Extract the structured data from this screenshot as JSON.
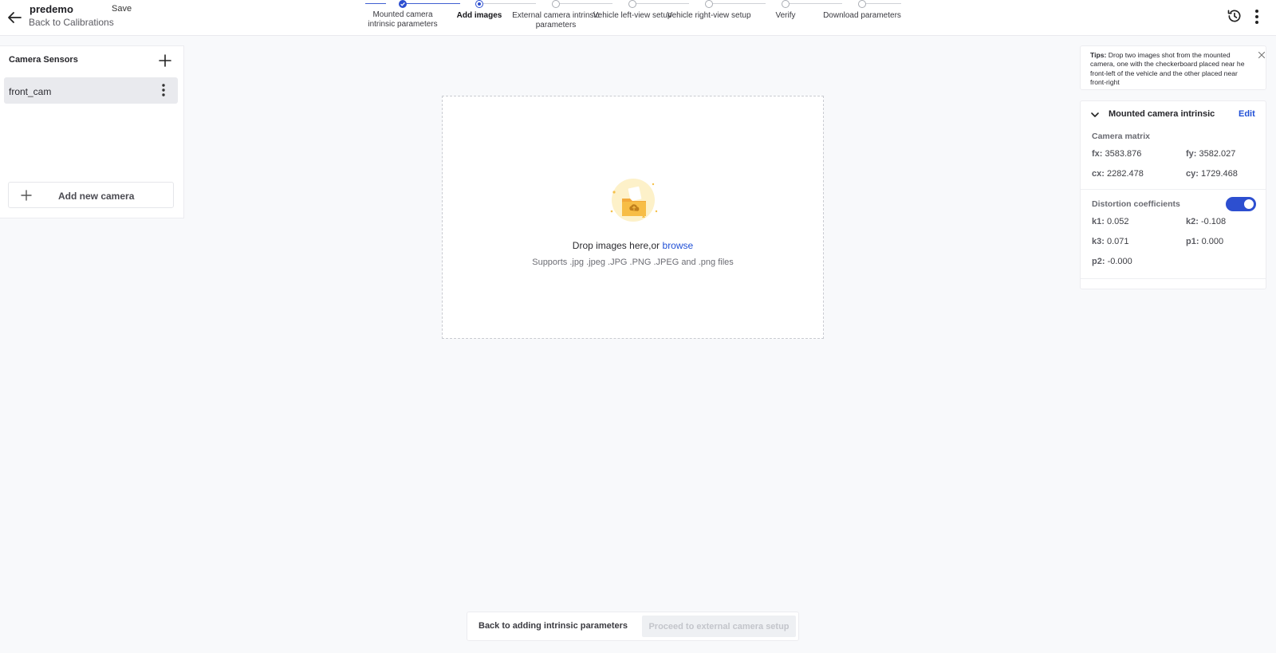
{
  "header": {
    "project_name": "predemo",
    "save_label": "Save",
    "back_link": "Back to Calibrations",
    "back_icon": "arrow-left-icon",
    "history_icon": "history-icon",
    "menu_icon": "kebab-icon"
  },
  "stepper": {
    "steps": [
      {
        "label": "Mounted camera intrinsic parameters",
        "state": "done"
      },
      {
        "label": "Add images",
        "state": "current"
      },
      {
        "label": "External camera intrinsic parameters",
        "state": "todo"
      },
      {
        "label": "Vehicle left-view setup",
        "state": "todo"
      },
      {
        "label": "Vehicle right-view setup",
        "state": "todo"
      },
      {
        "label": "Verify",
        "state": "todo"
      },
      {
        "label": "Download parameters",
        "state": "todo"
      }
    ],
    "accent": "#2d4fd0"
  },
  "sidebar": {
    "title": "Camera Sensors",
    "cameras": [
      {
        "name": "front_cam"
      }
    ],
    "add_camera_label": "Add new camera"
  },
  "dropzone": {
    "text": "Drop images here,or",
    "browse": "browse",
    "supports": "Supports .jpg .jpeg .JPG .PNG .JPEG and .png files",
    "illustration": "folder-upload-icon"
  },
  "tips": {
    "label": "Tips:",
    "text": "Drop two images shot from the mounted camera, one with the checkerboard placed near he front-left of the vehicle and the other placed near front-right"
  },
  "intrinsic": {
    "title": "Mounted camera intrinsic",
    "edit_label": "Edit",
    "camera_matrix_title": "Camera matrix",
    "matrix": [
      {
        "key": "fx:",
        "value": "3583.876"
      },
      {
        "key": "fy:",
        "value": "3582.027"
      },
      {
        "key": "cx:",
        "value": "2282.478"
      },
      {
        "key": "cy:",
        "value": "1729.468"
      }
    ],
    "distortion_title": "Distortion coefficients",
    "distortion_enabled": true,
    "distortion": [
      {
        "key": "k1:",
        "value": "0.052"
      },
      {
        "key": "k2:",
        "value": "-0.108"
      },
      {
        "key": "k3:",
        "value": "0.071"
      },
      {
        "key": "p1:",
        "value": "0.000"
      },
      {
        "key": "p2:",
        "value": "-0.000"
      }
    ]
  },
  "footer": {
    "back_label": "Back to adding intrinsic parameters",
    "proceed_label": "Proceed to external camera setup"
  }
}
